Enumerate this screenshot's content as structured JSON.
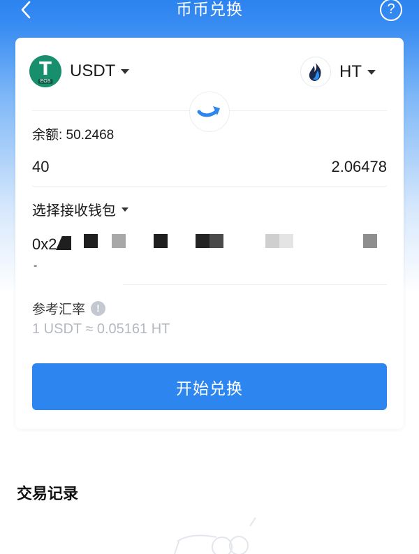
{
  "header": {
    "title": "币币兑换",
    "back_icon": "chevron-left-icon",
    "help_label": "?"
  },
  "colors": {
    "accent": "#2d86f0",
    "usdt_green": "#178f6c",
    "muted": "#b4b8c0",
    "divider": "#eceef2"
  },
  "exchange": {
    "from_token": {
      "symbol": "USDT",
      "logo_mark": "T",
      "logo_tag": "EOS",
      "icon": "usdt-eos-icon"
    },
    "to_token": {
      "symbol": "HT",
      "icon": "ht-flame-icon"
    },
    "balance": "余额: 50.2468",
    "input_amount": "40",
    "output_amount": "2.06478",
    "wallet_select_label": "选择接收钱包",
    "address_visible": "0x2",
    "address_mark": "-",
    "rate_label": "参考汇率",
    "rate_info_mark": "!",
    "rate_value": "1 USDT  ≈  0.05161 HT",
    "start_button": "开始兑换"
  },
  "records": {
    "title": "交易记录"
  }
}
